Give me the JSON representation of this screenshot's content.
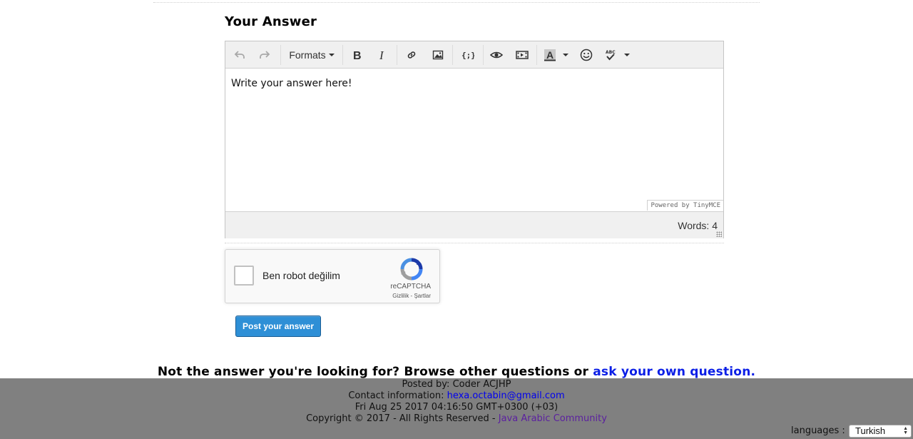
{
  "answer_section": {
    "heading": "Your Answer"
  },
  "editor": {
    "toolbar": {
      "formats_label": "Formats"
    },
    "content_text": "Write your answer here!",
    "branding": "Powered by TinyMCE",
    "word_count": "Words: 4"
  },
  "captcha": {
    "checkbox_label": "Ben robot değilim",
    "brand": "reCAPTCHA",
    "links": "Gizlilik - Şartlar"
  },
  "post_button": {
    "label": "Post your answer"
  },
  "not_answer": {
    "text": "Not the answer you're looking for? Browse other questions or",
    "link": "ask your own question."
  },
  "footer": {
    "posted_by": "Posted by: Coder ACJHP",
    "contact_label": "Contact information:",
    "contact_email": "hexa.octabin@gmail.com",
    "date": "Fri Aug 25 2017 04:16:50 GMT+0300 (+03)",
    "copyright": "Copyright © 2017 - All Rights Reserved -",
    "site_link": "Java Arabic Community",
    "languages_label": "languages :",
    "language_selected": "Turkish"
  },
  "colors": {
    "post_button": "#2e8fd6",
    "link": "#0a1ee6",
    "footer_bg": "#808080"
  }
}
